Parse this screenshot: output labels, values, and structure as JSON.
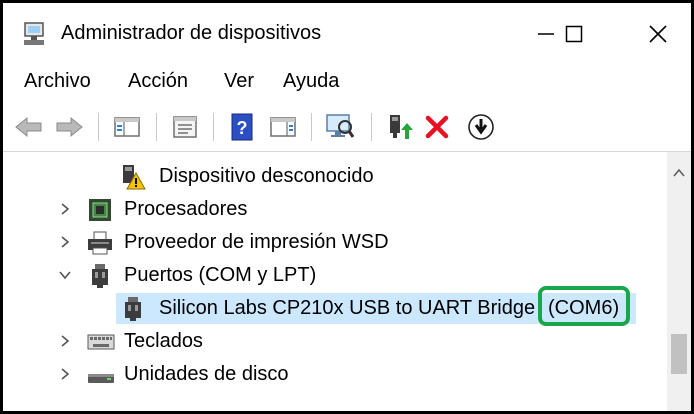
{
  "window": {
    "title": "Administrador de dispositivos",
    "icon": "device-manager-icon",
    "controls": [
      "minimize-icon",
      "maximize-icon",
      "close-icon"
    ]
  },
  "menu": {
    "items": [
      "Archivo",
      "Acción",
      "Ver",
      "Ayuda"
    ]
  },
  "toolbar": {
    "buttons": [
      "back-arrow-icon",
      "forward-arrow-icon",
      "show-hide-console-tree-icon",
      "properties-icon",
      "help-icon",
      "action-pane-icon",
      "scan-hardware-icon",
      "update-driver-icon",
      "uninstall-device-icon",
      "disable-device-icon"
    ]
  },
  "tree": {
    "unknown_device": "Dispositivo desconocido",
    "processors": "Procesadores",
    "print_provider": "Proveedor de impresión WSD",
    "ports": "Puertos (COM y LPT)",
    "cp210x_name": "Silicon Labs CP210x USB to UART Bridge",
    "cp210x_port": "(COM6)",
    "keyboards": "Teclados",
    "disk_units": "Unidades de disco"
  },
  "colors": {
    "selection": "#cce8ff",
    "highlight_box": "#1aa64a",
    "delete_x": "#e81123"
  }
}
